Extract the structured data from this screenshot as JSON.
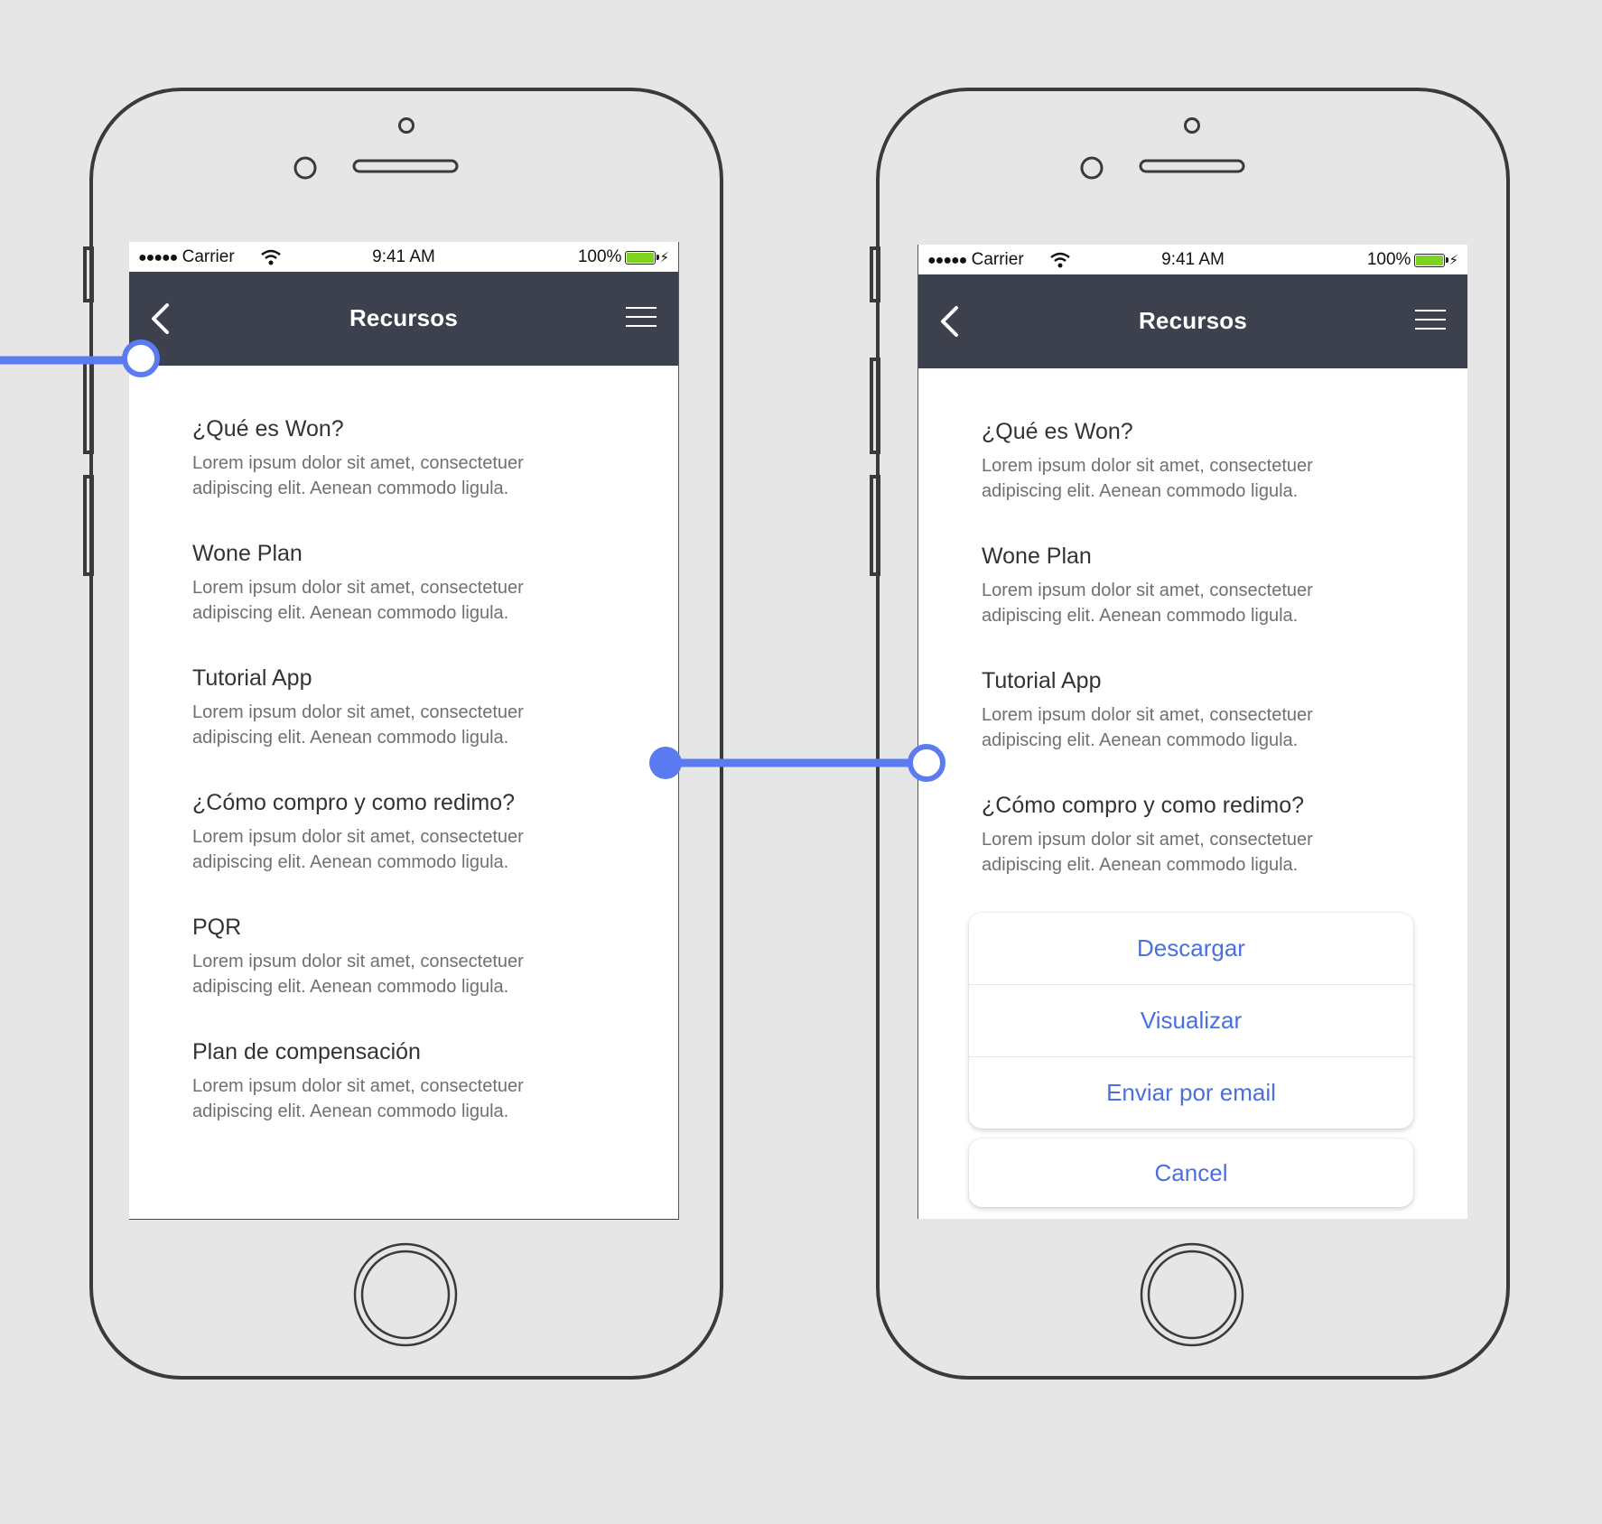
{
  "accent_color": "#5b7bf0",
  "screens": [
    {
      "status": {
        "carrier": "Carrier",
        "time": "9:41 AM",
        "battery": "100%"
      },
      "nav": {
        "title": "Recursos"
      },
      "items": [
        {
          "title": "¿Qué es Won?",
          "desc": "Lorem ipsum dolor sit amet, consectetuer adipiscing elit. Aenean commodo ligula."
        },
        {
          "title": "Wone Plan",
          "desc": "Lorem ipsum dolor sit amet, consectetuer adipiscing elit. Aenean commodo ligula."
        },
        {
          "title": "Tutorial App",
          "desc": "Lorem ipsum dolor sit amet, consectetuer adipiscing elit. Aenean commodo ligula."
        },
        {
          "title": "¿Cómo compro y como redimo?",
          "desc": "Lorem ipsum dolor sit amet, consectetuer adipiscing elit. Aenean commodo ligula."
        },
        {
          "title": "PQR",
          "desc": "Lorem ipsum dolor sit amet, consectetuer adipiscing elit. Aenean commodo ligula."
        },
        {
          "title": "Plan de compensación",
          "desc": "Lorem ipsum dolor sit amet, consectetuer adipiscing elit. Aenean commodo ligula."
        }
      ]
    },
    {
      "status": {
        "carrier": "Carrier",
        "time": "9:41 AM",
        "battery": "100%"
      },
      "nav": {
        "title": "Recursos"
      },
      "items": [
        {
          "title": "¿Qué es Won?",
          "desc": "Lorem ipsum dolor sit amet, consectetuer adipiscing elit. Aenean commodo ligula."
        },
        {
          "title": "Wone Plan",
          "desc": "Lorem ipsum dolor sit amet, consectetuer adipiscing elit. Aenean commodo ligula."
        },
        {
          "title": "Tutorial App",
          "desc": "Lorem ipsum dolor sit amet, consectetuer adipiscing elit. Aenean commodo ligula."
        },
        {
          "title": "¿Cómo compro y como redimo?",
          "desc": "Lorem ipsum dolor sit amet, consectetuer adipiscing elit. Aenean commodo ligula."
        }
      ],
      "action_sheet": {
        "options": [
          "Descargar",
          "Visualizar",
          "Enviar por email"
        ],
        "cancel": "Cancel"
      }
    }
  ]
}
